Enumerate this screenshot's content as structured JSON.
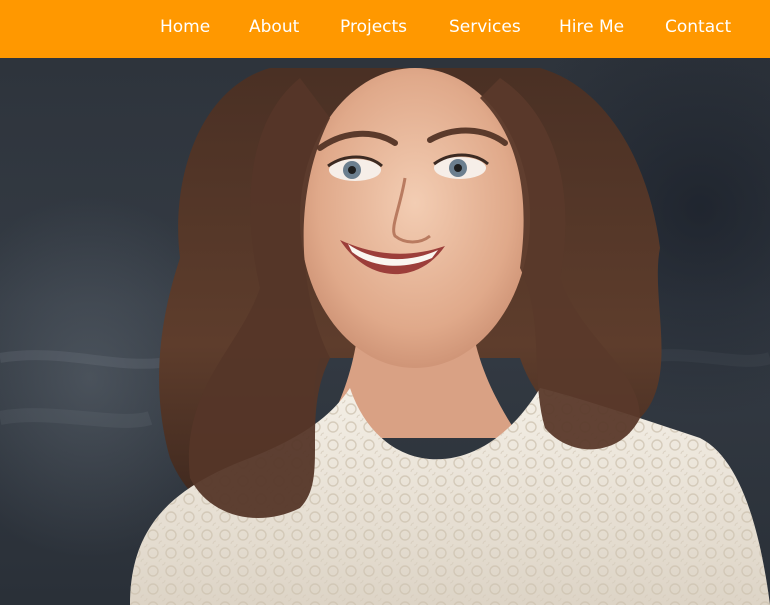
{
  "nav": {
    "items": [
      {
        "label": "Home"
      },
      {
        "label": "About"
      },
      {
        "label": "Projects"
      },
      {
        "label": "Services"
      },
      {
        "label": "Hire Me"
      },
      {
        "label": "Contact"
      }
    ]
  },
  "colors": {
    "nav_background": "#ff9800",
    "nav_text": "#ffffff"
  },
  "hero": {
    "image_icon": "portrait-photo"
  }
}
